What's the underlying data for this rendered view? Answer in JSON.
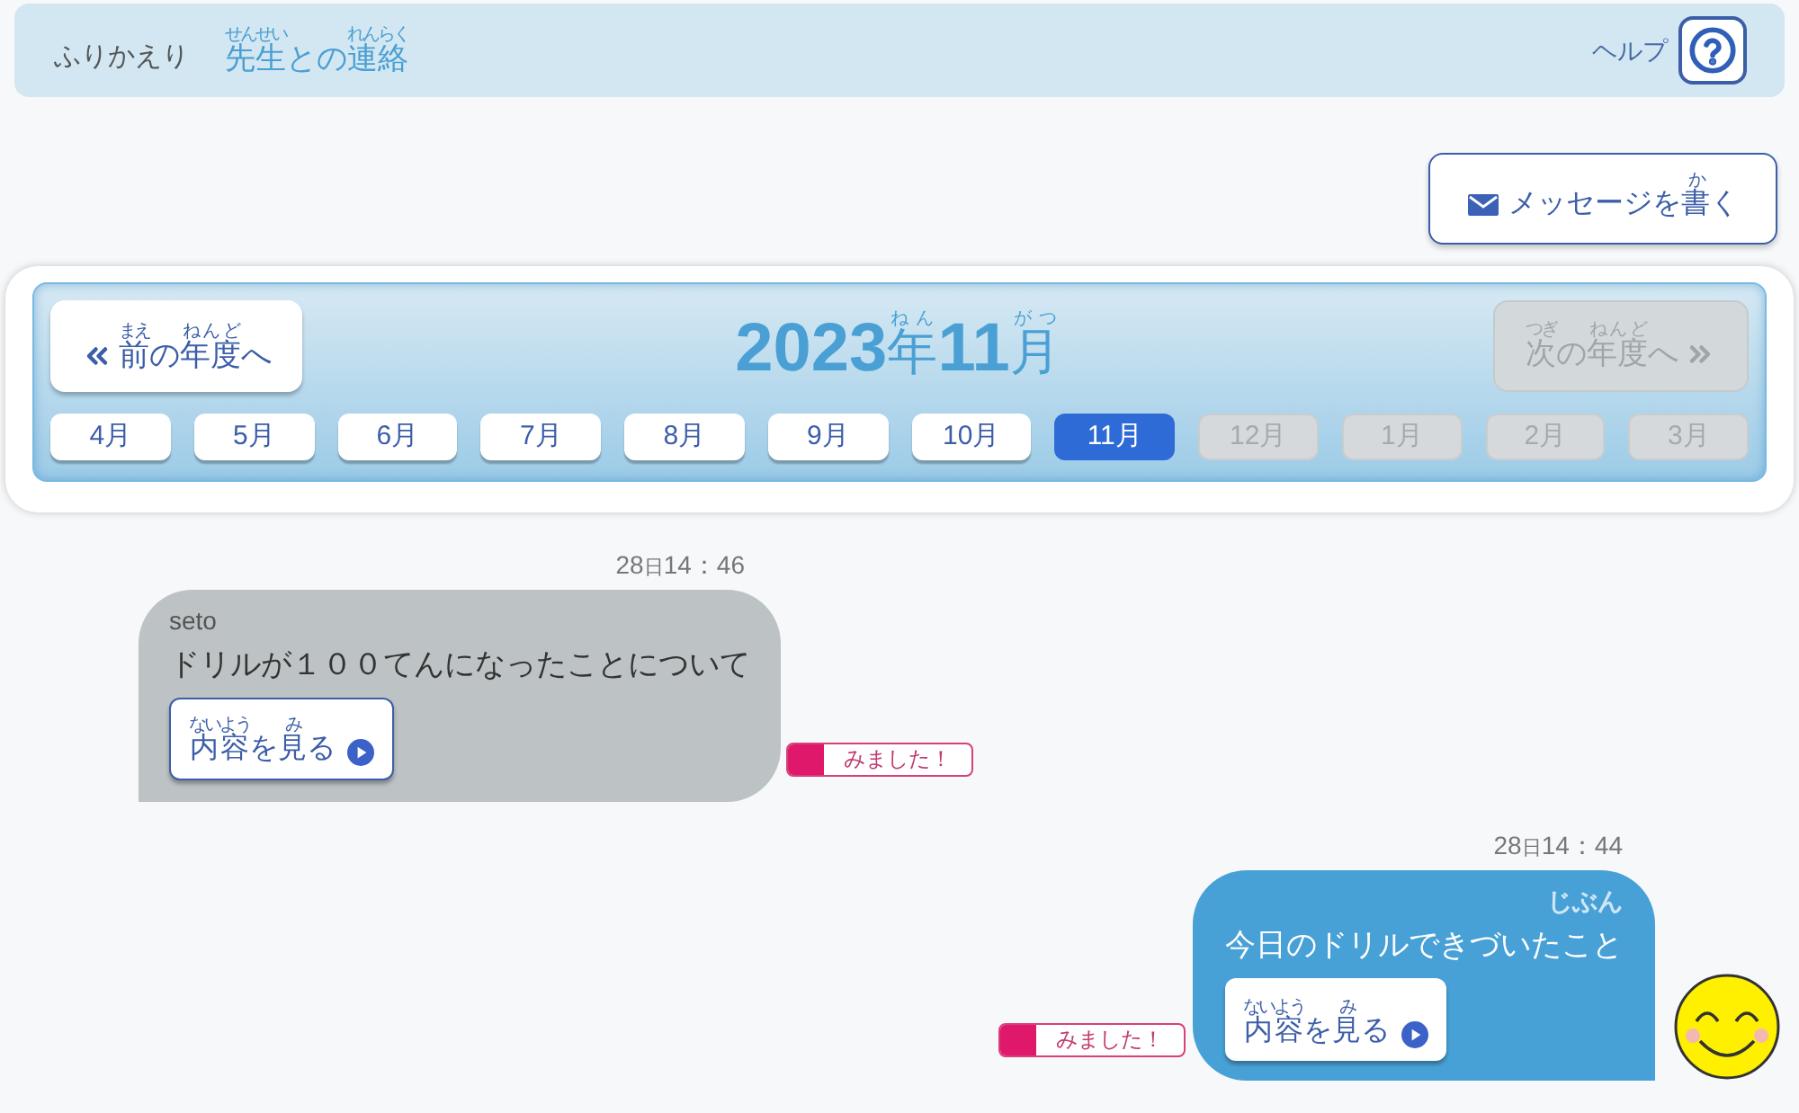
{
  "header": {
    "nav": [
      {
        "segments": [
          {
            "text": "ふりかえり"
          }
        ],
        "selected": false
      },
      {
        "segments": [
          {
            "text": "先生",
            "ruby": "せんせい"
          },
          {
            "text": "との"
          },
          {
            "text": "連絡",
            "ruby": "れんらく"
          }
        ],
        "selected": true
      }
    ],
    "help": {
      "label": "ヘルプ"
    }
  },
  "compose_button": {
    "segments": [
      {
        "text": "メッセージを"
      },
      {
        "text": "書",
        "ruby": "か"
      },
      {
        "text": "く"
      }
    ]
  },
  "calendar": {
    "prev": {
      "segments": [
        {
          "text": "前",
          "ruby": "まえ"
        },
        {
          "text": "の"
        },
        {
          "text": "年度",
          "ruby": "ねんど"
        },
        {
          "text": "へ"
        }
      ],
      "disabled": false
    },
    "title": [
      {
        "text": "2023",
        "kind": "number"
      },
      {
        "text": "年",
        "ruby": "ねん",
        "kind": "unit"
      },
      {
        "text": "11",
        "kind": "number"
      },
      {
        "text": "月",
        "ruby": "がつ",
        "kind": "unit"
      }
    ],
    "next": {
      "segments": [
        {
          "text": "次",
          "ruby": "つぎ"
        },
        {
          "text": "の"
        },
        {
          "text": "年度",
          "ruby": "ねんど"
        },
        {
          "text": "へ"
        }
      ],
      "disabled": true
    },
    "months": [
      {
        "label": "4月",
        "selected": false,
        "disabled": false
      },
      {
        "label": "5月",
        "selected": false,
        "disabled": false
      },
      {
        "label": "6月",
        "selected": false,
        "disabled": false
      },
      {
        "label": "7月",
        "selected": false,
        "disabled": false
      },
      {
        "label": "8月",
        "selected": false,
        "disabled": false
      },
      {
        "label": "9月",
        "selected": false,
        "disabled": false
      },
      {
        "label": "10月",
        "selected": false,
        "disabled": false
      },
      {
        "label": "11月",
        "selected": true,
        "disabled": false
      },
      {
        "label": "12月",
        "selected": false,
        "disabled": true
      },
      {
        "label": "1月",
        "selected": false,
        "disabled": true
      },
      {
        "label": "2月",
        "selected": false,
        "disabled": true
      },
      {
        "label": "3月",
        "selected": false,
        "disabled": true
      }
    ]
  },
  "messages": [
    {
      "kind": "received",
      "time": {
        "day": "28",
        "unit": "日",
        "clock": "14：46"
      },
      "sender": "seto",
      "text": "ドリルが１００てんになったことについて",
      "button": {
        "segments": [
          {
            "text": "内容",
            "ruby": "ないよう"
          },
          {
            "text": "を"
          },
          {
            "text": "見",
            "ruby": "み"
          },
          {
            "text": "る"
          }
        ]
      },
      "status": "みました！"
    },
    {
      "kind": "sent",
      "time": {
        "day": "28",
        "unit": "日",
        "clock": "14：44"
      },
      "sender": "じぶん",
      "text": "今日のドリルできづいたこと",
      "button": {
        "segments": [
          {
            "text": "内容",
            "ruby": "ないよう"
          },
          {
            "text": "を"
          },
          {
            "text": "見",
            "ruby": "み"
          },
          {
            "text": "る"
          }
        ]
      },
      "status": "みました！"
    }
  ]
}
